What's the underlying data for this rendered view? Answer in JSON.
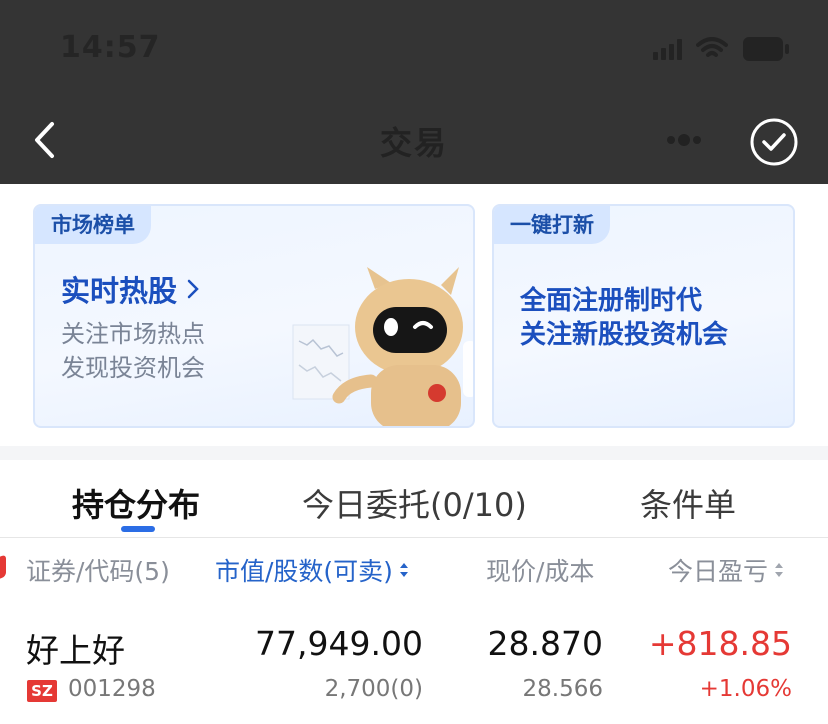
{
  "status_bar": {
    "time": "14:57"
  },
  "nav": {
    "title": "交易"
  },
  "banners": {
    "left": {
      "tag": "市场榜单",
      "title": "实时热股",
      "lines": [
        "关注市场热点",
        "发现投资机会"
      ]
    },
    "right": {
      "tag": "一键打新",
      "lines": [
        "全面注册制时代",
        "关注新股投资机会"
      ]
    }
  },
  "tabs": [
    {
      "label": "持仓分布",
      "active": true
    },
    {
      "label": "今日委托(0/10)",
      "active": false
    },
    {
      "label": "条件单",
      "active": false
    }
  ],
  "columns": [
    "证券/代码(5)",
    "市值/股数(可卖)",
    "现价/成本",
    "今日盈亏"
  ],
  "holding": {
    "name": "好上好",
    "exchange": "SZ",
    "code": "001298",
    "market_value": "77,949.00",
    "shares": "2,700(0)",
    "price": "28.870",
    "cost": "28.566",
    "pnl": "+818.85",
    "pnl_pct": "+1.06%"
  },
  "colors": {
    "accent": "#2563c9",
    "up": "#e53935",
    "header_bg": "#343434"
  }
}
